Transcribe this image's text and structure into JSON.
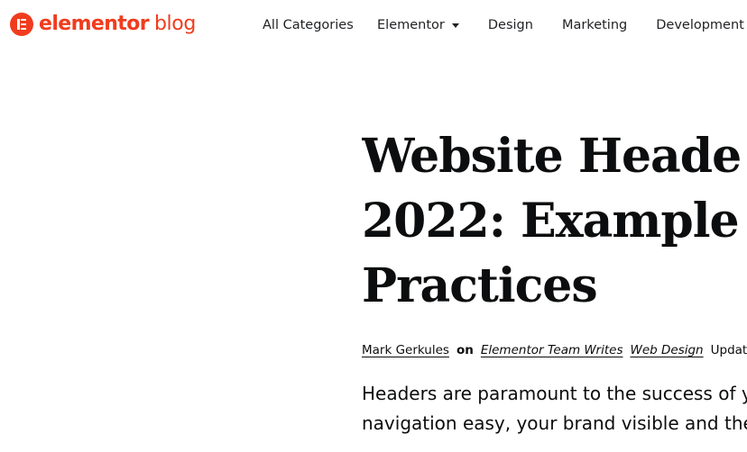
{
  "brand": {
    "name": "elementor",
    "sub": "blog",
    "color": "#f03c1e"
  },
  "nav": {
    "items": [
      {
        "label": "All Categories",
        "has_dropdown": false
      },
      {
        "label": "Elementor",
        "has_dropdown": true
      },
      {
        "label": "Design",
        "has_dropdown": false
      },
      {
        "label": "Marketing",
        "has_dropdown": false
      },
      {
        "label": "Development",
        "has_dropdown": false
      }
    ]
  },
  "article": {
    "title_lines": [
      "Website Heade",
      "2022: Example",
      "Practices"
    ],
    "meta": {
      "author": "Mark Gerkules",
      "on": "on",
      "categories": [
        "Elementor Team Writes",
        "Web Design"
      ],
      "updated": "Updat"
    },
    "excerpt_lines": [
      "Headers are paramount to the success of y",
      "navigation easy, your brand visible and they"
    ]
  }
}
